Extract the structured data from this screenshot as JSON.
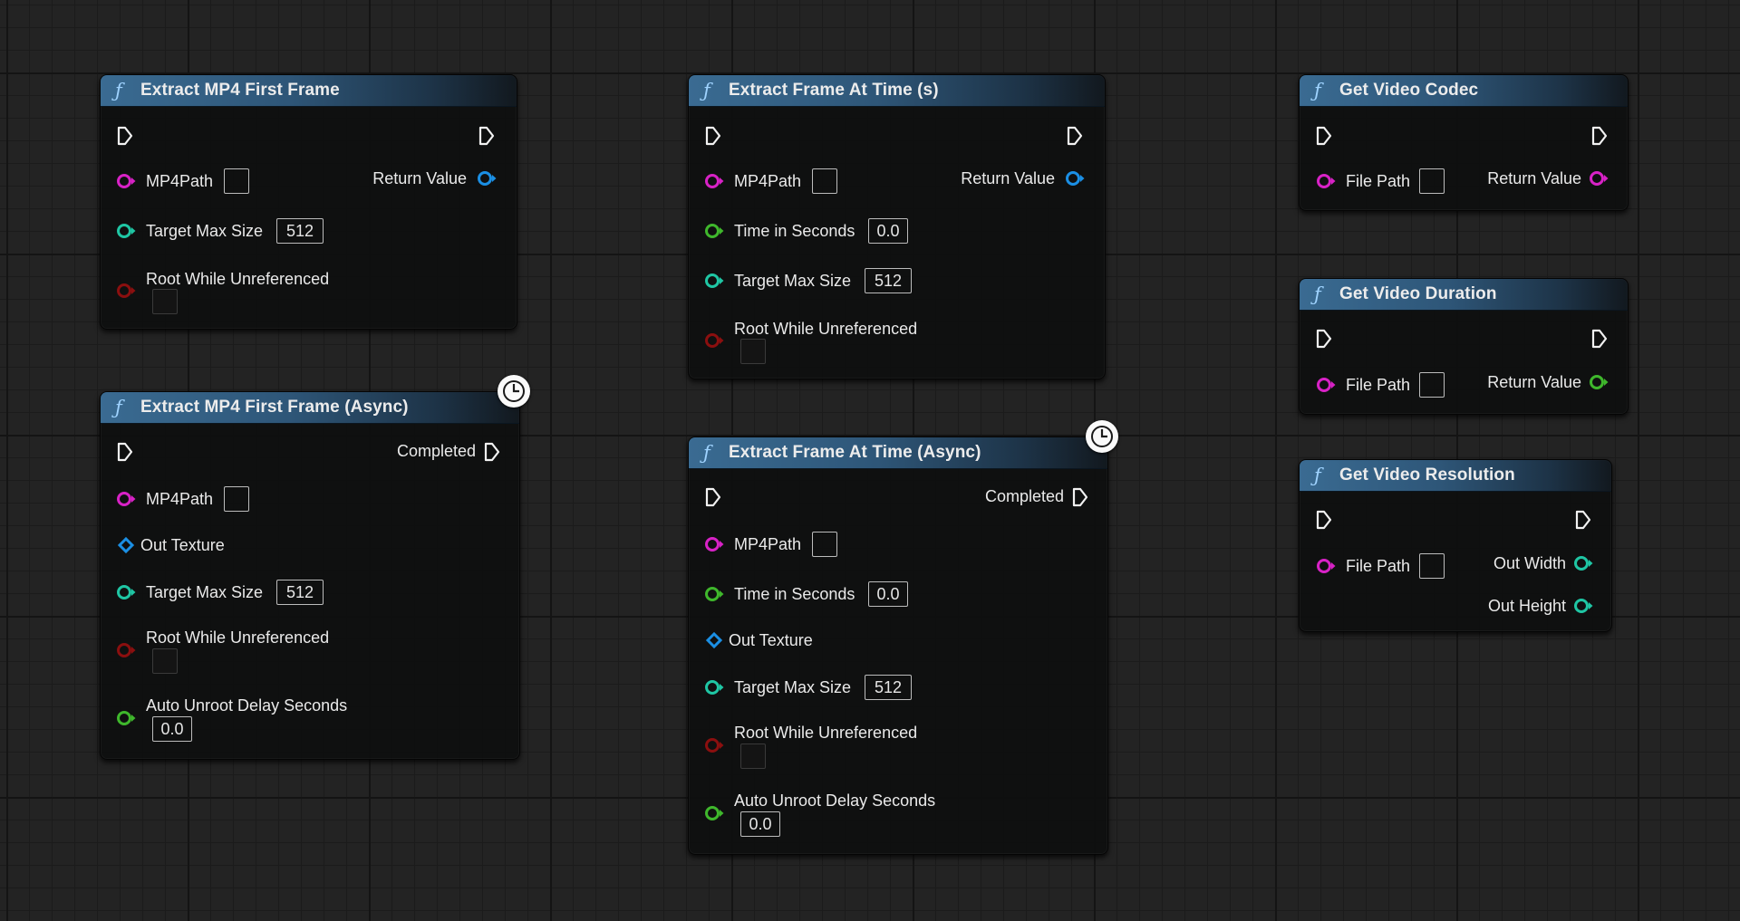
{
  "colors": {
    "string_pin": "#d822c6",
    "int_pin": "#1fc6a4",
    "float_pin": "#3fb72c",
    "bool_pin": "#8b0f0f",
    "object_pin": "#1b8fe4",
    "header": "#3a6b92"
  },
  "icons": {
    "function": "ƒ",
    "latent": "clock-icon",
    "exec": "exec-pin-icon"
  },
  "nodes": {
    "extract_first": {
      "title": "Extract MP4 First Frame",
      "mp4path": "MP4Path",
      "target_max_size": "Target Max Size",
      "target_max_size_value": "512",
      "root_while_unreferenced": "Root While Unreferenced",
      "return_value": "Return Value"
    },
    "extract_first_async": {
      "title": "Extract MP4 First Frame (Async)",
      "completed": "Completed",
      "mp4path": "MP4Path",
      "out_texture": "Out Texture",
      "target_max_size": "Target Max Size",
      "target_max_size_value": "512",
      "root_while_unreferenced": "Root While Unreferenced",
      "auto_unroot_delay": "Auto Unroot Delay Seconds",
      "auto_unroot_delay_value": "0.0"
    },
    "extract_at_time": {
      "title": "Extract Frame At Time (s)",
      "mp4path": "MP4Path",
      "time_in_seconds": "Time in Seconds",
      "time_in_seconds_value": "0.0",
      "target_max_size": "Target Max Size",
      "target_max_size_value": "512",
      "root_while_unreferenced": "Root While Unreferenced",
      "return_value": "Return Value"
    },
    "extract_at_time_async": {
      "title": "Extract Frame At Time (Async)",
      "completed": "Completed",
      "mp4path": "MP4Path",
      "time_in_seconds": "Time in Seconds",
      "time_in_seconds_value": "0.0",
      "out_texture": "Out Texture",
      "target_max_size": "Target Max Size",
      "target_max_size_value": "512",
      "root_while_unreferenced": "Root While Unreferenced",
      "auto_unroot_delay": "Auto Unroot Delay Seconds",
      "auto_unroot_delay_value": "0.0"
    },
    "get_codec": {
      "title": "Get Video Codec",
      "file_path": "File Path",
      "return_value": "Return Value"
    },
    "get_duration": {
      "title": "Get Video Duration",
      "file_path": "File Path",
      "return_value": "Return Value"
    },
    "get_resolution": {
      "title": "Get Video Resolution",
      "file_path": "File Path",
      "out_width": "Out Width",
      "out_height": "Out Height"
    }
  }
}
